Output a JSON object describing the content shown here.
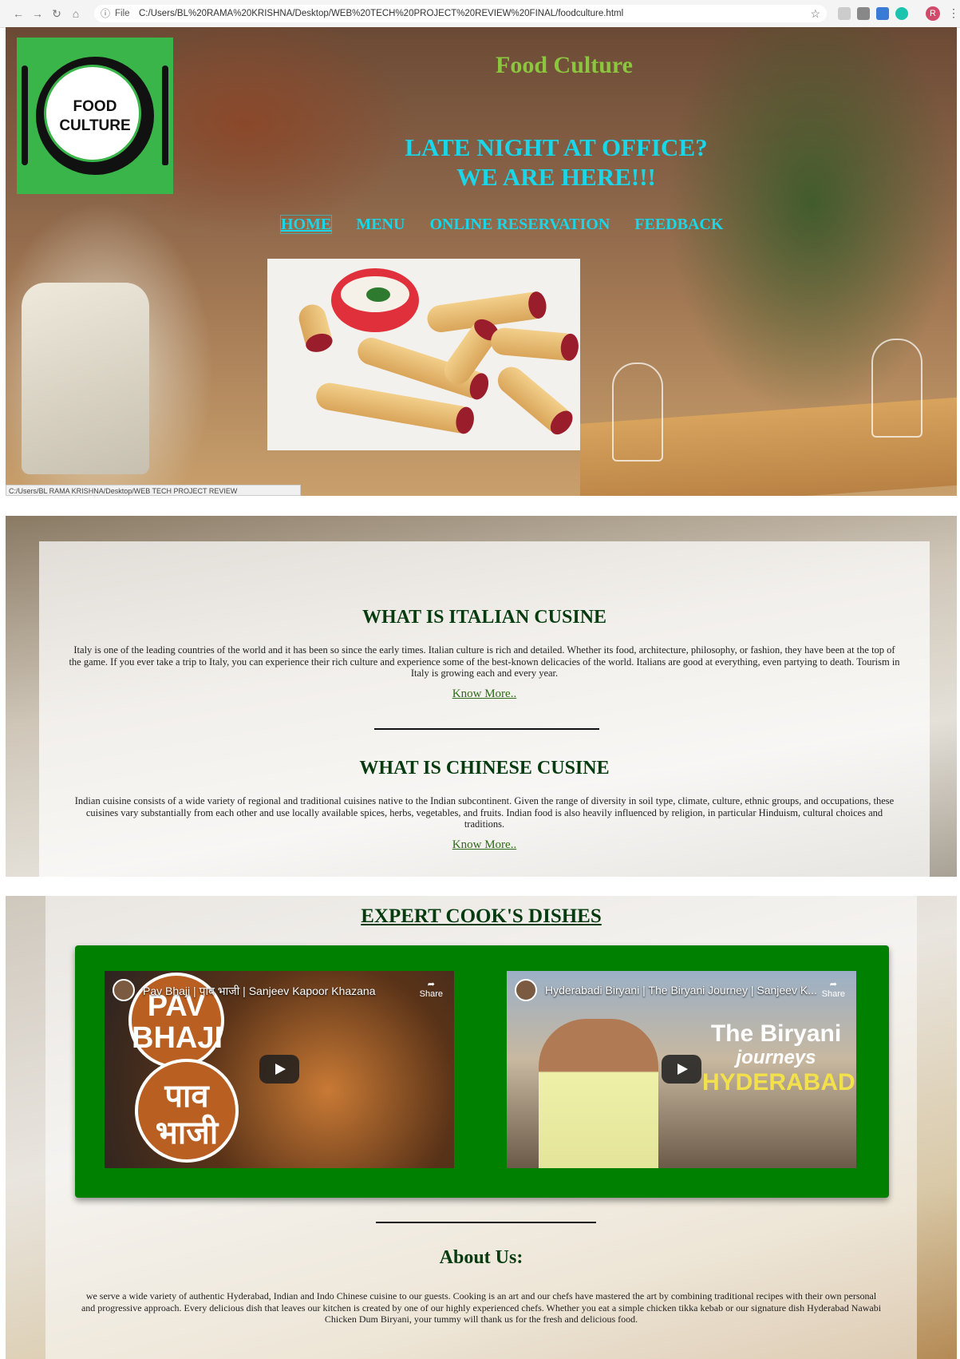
{
  "browser": {
    "scheme": "File",
    "url": "C:/Users/BL%20RAMA%20KRISHNA/Desktop/WEB%20TECH%20PROJECT%20REVIEW%20FINAL/foodculture.html",
    "profile_initial": "R",
    "status_url": "C:/Users/BL RAMA KRISHNA/Desktop/WEB TECH PROJECT REVIEW FINAL/foodculture.html"
  },
  "hero": {
    "logo_line1": "FOOD",
    "logo_line2": "CULTURE",
    "site_title": "Food Culture",
    "tagline_line1": "LATE NIGHT AT OFFICE?",
    "tagline_line2": "WE ARE HERE!!!",
    "nav": [
      "HOME",
      "MENU",
      "ONLINE RESERVATION",
      "FEEDBACK"
    ]
  },
  "cuisines": [
    {
      "heading": "WHAT IS ITALIAN CUSINE",
      "text": "Italy is one of the leading countries of the world and it has been so since the early times. Italian culture is rich and detailed. Whether its food, architecture, philosophy, or fashion, they have been at the top of the game. If you ever take a trip to Italy, you can experience their rich culture and experience some of the best-known delicacies of the world. Italians are good at everything, even partying to death. Tourism in Italy is growing each and every year.",
      "link": "Know More.."
    },
    {
      "heading": "WHAT IS CHINESE CUSINE",
      "text": "Indian cuisine consists of a wide variety of regional and traditional cuisines native to the Indian subcontinent. Given the range of diversity in soil type, climate, culture, ethnic groups, and occupations, these cuisines vary substantially from each other and use locally available spices, herbs, vegetables, and fruits. Indian food is also heavily influenced by religion, in particular Hinduism, cultural choices and traditions.",
      "link": "Know More.."
    }
  ],
  "expert": {
    "title": "EXPERT COOK'S DISHES",
    "videos": [
      {
        "title": "Pav Bhaji | पाव भाजी | Sanjeev Kapoor Khazana",
        "share": "Share",
        "overlay1": "PAV BHAJI",
        "overlay2": "पाव भाजी"
      },
      {
        "title": "Hyderabadi Biryani | The Biryani Journey | Sanjeev K...",
        "share": "Share",
        "overlay1": "The Biryani",
        "overlay2": "journeys",
        "overlay3": "HYDERABAD"
      }
    ]
  },
  "about": {
    "title": "About Us:",
    "text": "we serve a wide variety of authentic Hyderabad, Indian and Indo Chinese cuisine to our guests. Cooking is an art and our chefs have mastered the art by combining traditional recipes with their own personal and progressive approach. Every delicious dish that leaves our kitchen is created by one of our highly experienced chefs. Whether you eat a simple chicken tikka kebab or our signature dish Hyderabad Nawabi Chicken Dum Biryani, your tummy will thank us for the fresh and delicious food."
  },
  "colors": {
    "logo_green": "#39b54a",
    "title_green": "#8cc63f",
    "cyan": "#1ad6e8",
    "dark_green": "#063b10",
    "frame_green": "#008000"
  }
}
